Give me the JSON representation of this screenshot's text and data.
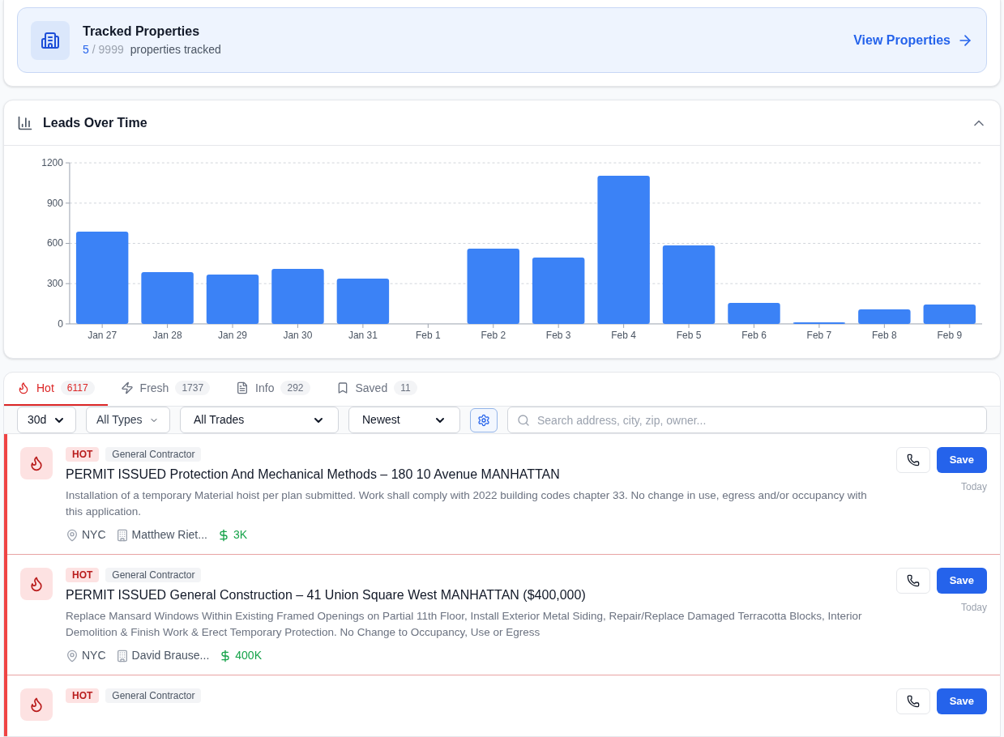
{
  "tracked": {
    "title": "Tracked Properties",
    "count": "5",
    "limit": "/ 9999",
    "label": "properties tracked",
    "link": "View Properties"
  },
  "chart_panel": {
    "title": "Leads Over Time",
    "expanded": true,
    "chart_data": {
      "type": "bar",
      "categories": [
        "Jan 27",
        "Jan 28",
        "Jan 29",
        "Jan 30",
        "Jan 31",
        "Feb 1",
        "Feb 2",
        "Feb 3",
        "Feb 4",
        "Feb 5",
        "Feb 6",
        "Feb 7",
        "Feb 8",
        "Feb 9"
      ],
      "grid": true,
      "series": [
        {
          "color": "#3b82f6",
          "values": [
            688,
            386,
            368,
            410,
            338,
            0,
            561,
            494,
            1104,
            585,
            157,
            12,
            108,
            145
          ]
        }
      ],
      "ylim": [
        0,
        1200
      ],
      "yticks": [
        0,
        300,
        600,
        900,
        1200
      ]
    }
  },
  "tabs": [
    {
      "kind": "hot",
      "label": "Hot",
      "count": "6117",
      "selected": true
    },
    {
      "kind": "fresh",
      "label": "Fresh",
      "count": "1737",
      "selected": false
    },
    {
      "kind": "info",
      "label": "Info",
      "count": "292",
      "selected": false
    },
    {
      "kind": "saved",
      "label": "Saved",
      "count": "11",
      "selected": false
    }
  ],
  "filters": {
    "period": "30d",
    "types": "All Types",
    "trades": "All Trades",
    "sort": "Newest",
    "search_placeholder": "Search address, city, zip, owner..."
  },
  "leads": [
    {
      "badge": "HOT",
      "trade": "General Contractor",
      "title": "PERMIT ISSUED Protection And Mechanical Methods – 180 10 Avenue MANHATTAN",
      "description": "Installation of a temporary Material hoist per plan submitted. Work shall comply with 2022 building codes chapter 33. No change in use, egress and/or occupancy with this application.",
      "location": "NYC",
      "owner": "Matthew Riet...",
      "value": "3K",
      "save": "Save",
      "time": "Today"
    },
    {
      "badge": "HOT",
      "trade": "General Contractor",
      "title": "PERMIT ISSUED General Construction – 41 Union Square West MANHATTAN ($400,000)",
      "description": "Replace Mansard Windows Within Existing Framed Openings on Partial 11th Floor, Install Exterior Metal Siding, Repair/Replace Damaged Terracotta Blocks, Interior Demolition & Finish Work & Erect Temporary Protection. No Change to Occupancy, Use or Egress",
      "location": "NYC",
      "owner": "David Brause...",
      "value": "400K",
      "save": "Save",
      "time": "Today"
    },
    {
      "badge": "HOT",
      "trade": "General Contractor",
      "save": "Save"
    }
  ]
}
